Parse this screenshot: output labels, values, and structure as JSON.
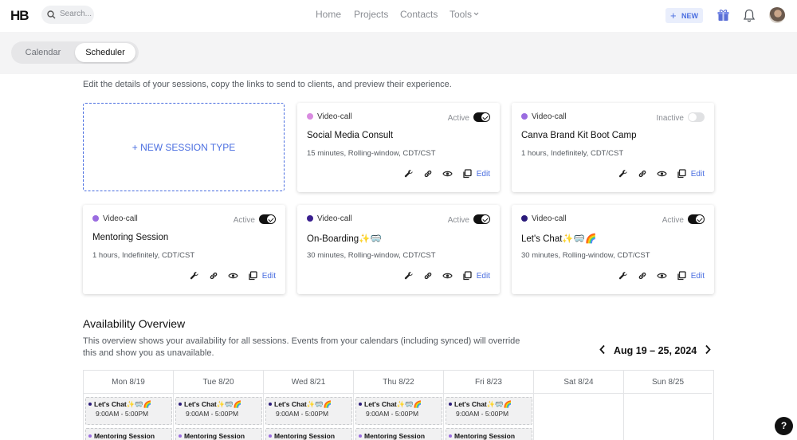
{
  "header": {
    "logo": "HB",
    "search_placeholder": "Search...",
    "nav": [
      "Home",
      "Projects",
      "Contacts",
      "Tools"
    ],
    "new_label": "NEW",
    "icons": [
      "search-icon",
      "chevron-down-icon",
      "plus-icon",
      "gift-icon",
      "bell-icon",
      "avatar"
    ]
  },
  "tabs": {
    "calendar": "Calendar",
    "scheduler": "Scheduler"
  },
  "intro": "Edit the details of your sessions, copy the links to send to clients, and preview their experience.",
  "new_session": "+ NEW SESSION TYPE",
  "edit_label": "Edit",
  "sessions": [
    {
      "type": "Video-call",
      "dot_color": "#d98be0",
      "status": "Active",
      "active": true,
      "name": "Social Media Consult",
      "meta": "15 minutes, Rolling-window, CDT/CST"
    },
    {
      "type": "Video-call",
      "dot_color": "#9a6ce0",
      "status": "Inactive",
      "active": false,
      "name": "Canva Brand Kit Boot Camp",
      "meta": "1 hours, Indefinitely, CDT/CST"
    },
    {
      "type": "Video-call",
      "dot_color": "#9a6ce0",
      "status": "Active",
      "active": true,
      "name": "Mentoring Session",
      "meta": "1 hours, Indefinitely, CDT/CST"
    },
    {
      "type": "Video-call",
      "dot_color": "#3a1f8f",
      "status": "Active",
      "active": true,
      "name": "On-Boarding✨🥽",
      "meta": "30 minutes, Rolling-window, CDT/CST"
    },
    {
      "type": "Video-call",
      "dot_color": "#2a1a7a",
      "status": "Active",
      "active": true,
      "name": "Let's Chat✨🥽🌈",
      "meta": "30 minutes, Rolling-window, CDT/CST"
    }
  ],
  "availability": {
    "title": "Availability Overview",
    "description": "This overview shows your availability for all sessions. Events from your calendars (including synced) will override this and show you as unavailable.",
    "range": "Aug 19 – 25, 2024",
    "days": [
      "Mon 8/19",
      "Tue 8/20",
      "Wed 8/21",
      "Thu 8/22",
      "Fri 8/23",
      "Sat 8/24",
      "Sun 8/25"
    ],
    "events": [
      {
        "title": "Let's Chat✨🥽🌈",
        "hours": "9:00AM - 5:00PM"
      },
      {
        "title": "Mentoring Session"
      }
    ]
  },
  "help_label": "?"
}
